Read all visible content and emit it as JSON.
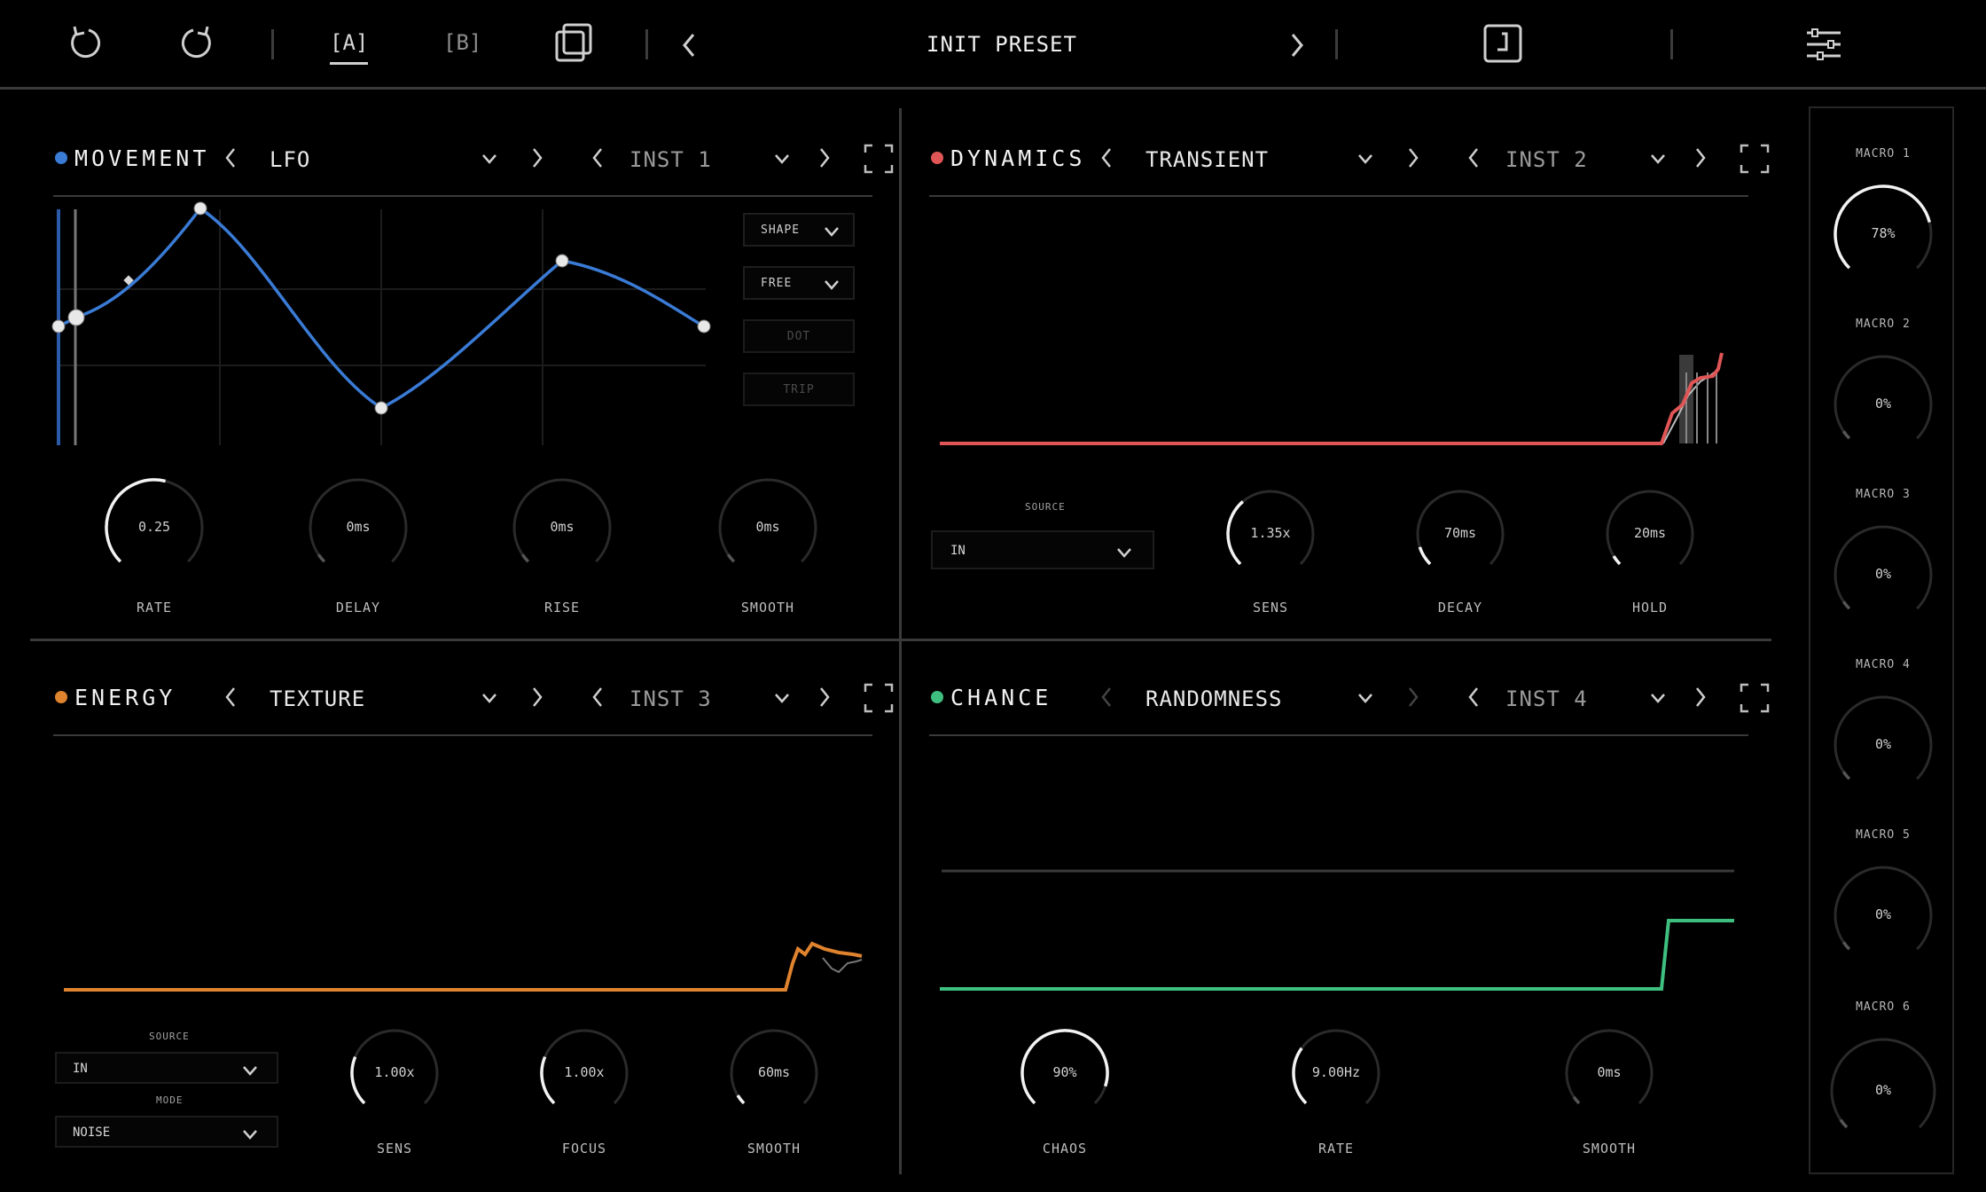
{
  "topbar": {
    "tabs": [
      "[A]",
      "[B]"
    ],
    "preset_name": "INIT PRESET",
    "icons": [
      "undo-icon",
      "redo-icon",
      "copy-icon",
      "prev-preset-icon",
      "next-preset-icon",
      "save-icon",
      "menu-icon"
    ]
  },
  "panels": {
    "movement": {
      "title": "MOVEMENT",
      "color": "#3a7bd5",
      "type": "LFO",
      "inst": "INST 1",
      "buttons": [
        "SHAPE",
        "FREE",
        "DOT",
        "TRIP"
      ],
      "knobs": [
        {
          "value": "0.25",
          "label": "RATE",
          "level": 0.55
        },
        {
          "value": "0ms",
          "label": "DELAY",
          "level": 0.0
        },
        {
          "value": "0ms",
          "label": "RISE",
          "level": 0.0
        },
        {
          "value": "0ms",
          "label": "SMOOTH",
          "level": 0.0
        }
      ]
    },
    "dynamics": {
      "title": "DYNAMICS",
      "color": "#e05555",
      "type": "TRANSIENT",
      "inst": "INST 2",
      "source_label": "SOURCE",
      "source_value": "IN",
      "knobs": [
        {
          "value": "1.35x",
          "label": "SENS",
          "level": 0.35
        },
        {
          "value": "70ms",
          "label": "DECAY",
          "level": 0.1
        },
        {
          "value": "20ms",
          "label": "HOLD",
          "level": 0.05
        }
      ]
    },
    "energy": {
      "title": "ENERGY",
      "color": "#e0832e",
      "type": "TEXTURE",
      "inst": "INST 3",
      "source_label": "SOURCE",
      "source_value": "IN",
      "mode_label": "MODE",
      "mode_value": "NOISE",
      "knobs": [
        {
          "value": "1.00x",
          "label": "SENS",
          "level": 0.25
        },
        {
          "value": "1.00x",
          "label": "FOCUS",
          "level": 0.25
        },
        {
          "value": "60ms",
          "label": "SMOOTH",
          "level": 0.05
        }
      ]
    },
    "chance": {
      "title": "CHANCE",
      "color": "#3fbf7f",
      "type": "RANDOMNESS",
      "inst": "INST 4",
      "knobs": [
        {
          "value": "90%",
          "label": "CHAOS",
          "level": 0.9
        },
        {
          "value": "9.00Hz",
          "label": "RATE",
          "level": 0.3
        },
        {
          "value": "0ms",
          "label": "SMOOTH",
          "level": 0.0
        }
      ]
    }
  },
  "macros": [
    {
      "label": "MACRO 1",
      "value": "78%",
      "level": 0.78
    },
    {
      "label": "MACRO 2",
      "value": "0%",
      "level": 0
    },
    {
      "label": "MACRO 3",
      "value": "0%",
      "level": 0
    },
    {
      "label": "MACRO 4",
      "value": "0%",
      "level": 0
    },
    {
      "label": "MACRO 5",
      "value": "0%",
      "level": 0
    },
    {
      "label": "MACRO 6",
      "value": "0%",
      "level": 0
    }
  ]
}
